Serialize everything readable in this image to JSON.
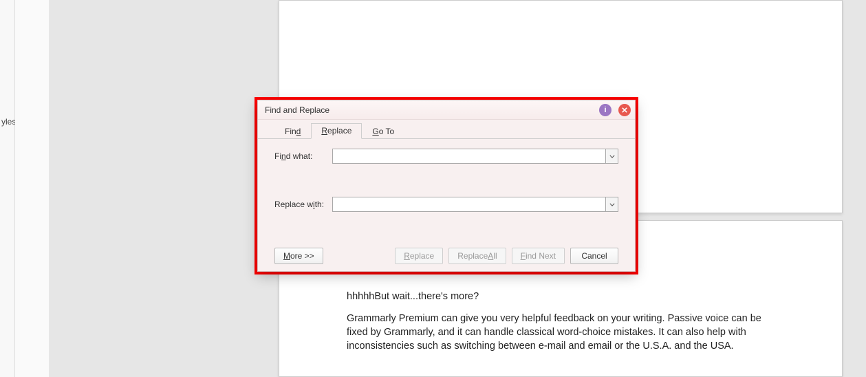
{
  "sidebar": {
    "styles_label": "yles"
  },
  "document": {
    "line1": "hhhhhBut wait...there's more?",
    "para2": "Grammarly Premium can give you very helpful feedback on your writing. Passive voice can be fixed by Grammarly, and it can handle classical word-choice mistakes. It can also help with inconsistencies such as switching between e-mail and email or the U.S.A. and the USA."
  },
  "dialog": {
    "title": "Find and Replace",
    "info_icon": "i",
    "tabs": {
      "find_prefix": "Fin",
      "find_ul": "d",
      "replace_ul": "R",
      "replace_rest": "eplace",
      "goto_ul": "G",
      "goto_rest": "o To"
    },
    "find_label_prefix": "Fi",
    "find_label_ul": "n",
    "find_label_suffix": "d what:",
    "find_value": "",
    "replace_label_prefix": "Replace w",
    "replace_label_ul": "i",
    "replace_label_suffix": "th:",
    "replace_value": "",
    "buttons": {
      "more_ul": "M",
      "more_rest": "ore >>",
      "replace_ul": "R",
      "replace_rest": "eplace",
      "replace_all_prefix": "Replace ",
      "replace_all_ul": "A",
      "replace_all_suffix": "ll",
      "find_next_ul": "F",
      "find_next_rest": "ind Next",
      "cancel": "Cancel"
    }
  }
}
